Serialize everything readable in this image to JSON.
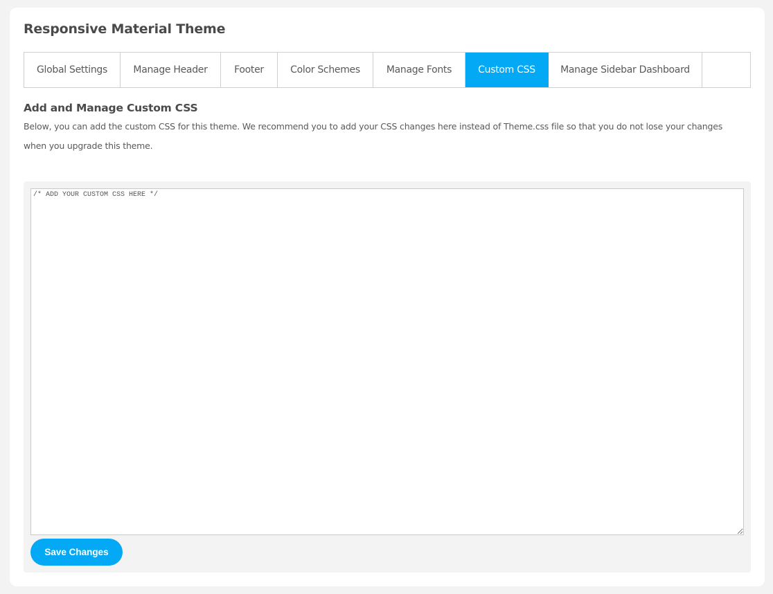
{
  "page": {
    "title": "Responsive Material Theme"
  },
  "tabs": [
    {
      "label": "Global Settings",
      "active": false
    },
    {
      "label": "Manage Header",
      "active": false
    },
    {
      "label": "Footer",
      "active": false
    },
    {
      "label": "Color Schemes",
      "active": false
    },
    {
      "label": "Manage Fonts",
      "active": false
    },
    {
      "label": "Custom CSS",
      "active": true
    },
    {
      "label": "Manage Sidebar Dashboard",
      "active": false
    }
  ],
  "section": {
    "heading": "Add and Manage Custom CSS",
    "description": "Below, you can add the custom CSS for this theme. We recommend you to add your CSS changes here instead of Theme.css file so that you do not lose your changes when you upgrade this theme."
  },
  "editor": {
    "value": "/* ADD YOUR CUSTOM CSS HERE */"
  },
  "actions": {
    "save_label": "Save Changes"
  },
  "colors": {
    "accent": "#03a9f4",
    "background": "#f3f3f3",
    "card": "#ffffff",
    "text": "#555555"
  }
}
